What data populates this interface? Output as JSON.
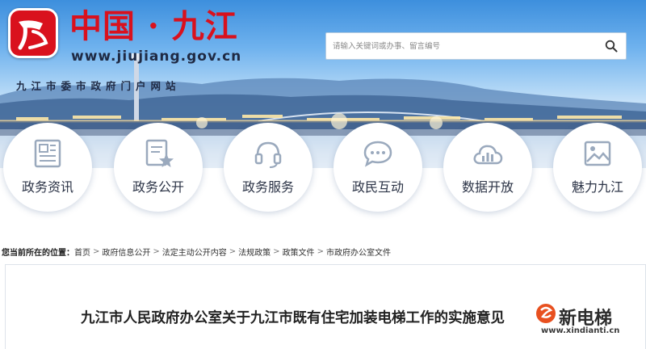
{
  "header": {
    "site_title": "中国 · 九江",
    "site_url": "www.jiujiang.gov.cn",
    "site_subtitle": "九江市委市政府门户网站"
  },
  "search": {
    "placeholder": "请输入关键词或办事、留言编号",
    "icon": "search-icon"
  },
  "nav": {
    "items": [
      {
        "label": "政务资讯",
        "icon": "news-icon"
      },
      {
        "label": "政务公开",
        "icon": "document-star-icon"
      },
      {
        "label": "政务服务",
        "icon": "headset-icon"
      },
      {
        "label": "政民互动",
        "icon": "chat-icon"
      },
      {
        "label": "数据开放",
        "icon": "cloud-chart-icon"
      },
      {
        "label": "魅力九江",
        "icon": "picture-icon"
      }
    ]
  },
  "breadcrumb": {
    "label": "您当前所在的位置：",
    "items": [
      "首页",
      "政府信息公开",
      "法定主动公开内容",
      "法规政策",
      "政策文件",
      "市政府办公室文件"
    ]
  },
  "document": {
    "title": "九江市人民政府办公室关于九江市既有住宅加装电梯工作的实施意见"
  },
  "watermark": {
    "name": "新电梯",
    "url": "www.xindianti.cn"
  },
  "colors": {
    "brand_red": "#d9111d",
    "icon_blue": "#9aa9bd",
    "text_dark": "#2b3346"
  }
}
